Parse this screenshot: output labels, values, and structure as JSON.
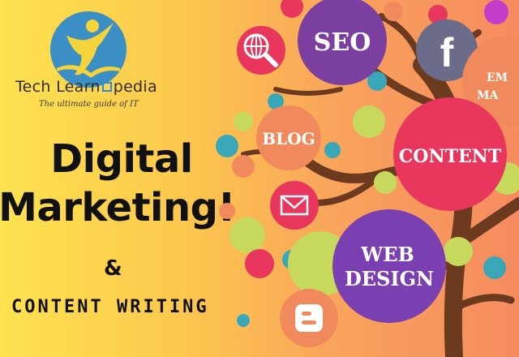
{
  "brand": {
    "name_part1": "Tech Learn",
    "name_part2": "pedia",
    "tagline": "The ultimate guide of IT"
  },
  "headline": {
    "line1": "Digital",
    "line2": "Marketing!",
    "ampersand": "&",
    "subtitle": "CONTENT WRITING"
  },
  "bubbles": {
    "seo": "SEO",
    "blog": "BLOG",
    "content": "CONTENT",
    "web_design_1": "WEB",
    "web_design_2": "DESIGN",
    "email_partial_1": "EM",
    "email_partial_2": "MA"
  },
  "icons": [
    "web-search-icon",
    "facebook-icon",
    "mail-icon",
    "blogger-icon",
    "person-logo-icon"
  ],
  "colors": {
    "seo": "#7b3fa0",
    "content": "#e8365d",
    "web_design": "#7a3fb0",
    "blog": "#f08a5d",
    "facebook": "#6b6b8a",
    "trunk": "#6b3a1f"
  }
}
